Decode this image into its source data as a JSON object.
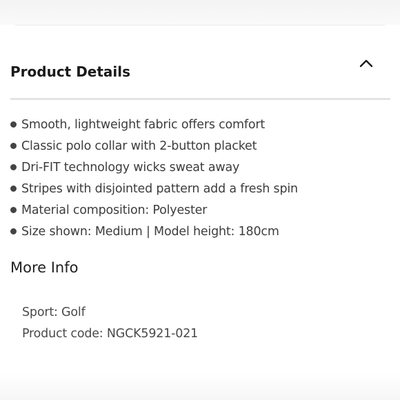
{
  "product_details": {
    "title": "Product Details",
    "toggle_icon": "chevron-up-icon",
    "bullet_icon": "bullet-icon",
    "items": [
      "Smooth, lightweight fabric offers comfort",
      "Classic polo collar with 2-button placket",
      "Dri-FIT technology wicks sweat away",
      "Stripes with disjointed pattern add a fresh spin",
      "Material composition: Polyester",
      "Size shown: Medium | Model height: 180cm"
    ]
  },
  "more_info": {
    "title": "More Info",
    "items": [
      "Sport: Golf",
      "Product code: NGCK5921-021"
    ]
  },
  "colors": {
    "text": "#3d3d3d",
    "heading": "#1a1a1a",
    "divider": "#e3e3e3"
  }
}
